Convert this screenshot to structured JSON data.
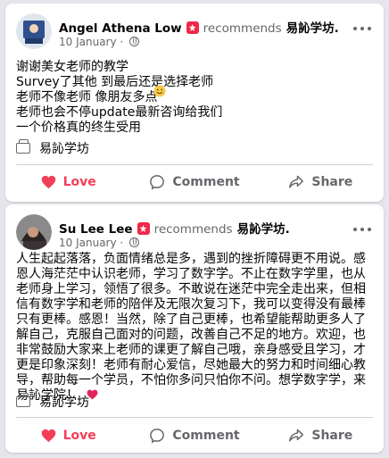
{
  "posts": [
    {
      "author": "Angel Athena Low",
      "recommends_text": "recommends",
      "page_name": "易訫学坊.",
      "date": "10 January",
      "body": "谢谢美女老师的教学\nSurvey了其他 到最后还是选择老师\n老师不像老师 像朋友多点   \n老师也会不停update最新咨询给我们\n一个价格真的终生受用",
      "tag_label": "易訫学坊",
      "actions": {
        "love": "Love",
        "comment": "Comment",
        "share": "Share"
      }
    },
    {
      "author": "Su Lee Lee",
      "recommends_text": "recommends",
      "page_name": "易訫学坊.",
      "date": "10 January",
      "body": "人生起起落落，负面情绪总是多，遇到的挫折障碍更不用说。感恩人海茫茫中认识老师，学习了数字学。不止在数字学里，也从老师身上学习，领悟了很多。不敢说在迷茫中完全走出来，但相信有数字学和老师的陪伴及无限次复习下，我可以变得没有最棒只有更棒。感恩！当然，除了自己更棒，也希望能帮助更多人了解自己，克服自己面对的问题，改善自己不足的地方。欢迎，也非常鼓励大家来上老师的课更了解自己哦，亲身感受且学习，才更是印象深刻！老师有耐心爱信，尽她最大的努力和时间细心教导，帮助每一个学员，不怕你多问只怕你不问。想学数字学，来易訫学院！",
      "tag_label": "易訫学坊",
      "actions": {
        "love": "Love",
        "comment": "Comment",
        "share": "Share"
      }
    }
  ],
  "colors": {
    "love": "#f33e58",
    "secondary": "#65676b",
    "recommend_badge": "#f02849"
  },
  "icons": [
    "more-icon",
    "globe-icon",
    "recommend-icon",
    "page-tag-icon",
    "love-icon",
    "comment-icon",
    "share-icon",
    "smile-emoji",
    "heart-emoji"
  ]
}
